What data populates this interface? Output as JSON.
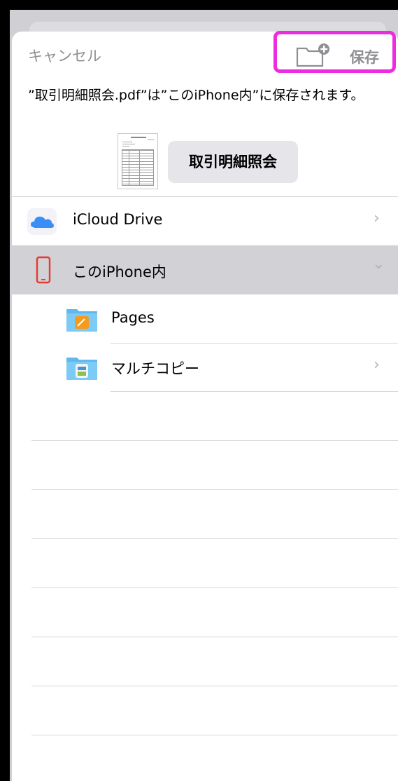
{
  "header": {
    "cancel_label": "キャンセル",
    "save_label": "保存",
    "new_folder_icon": "folder-plus-icon"
  },
  "message": "”取引明細照会.pdf”は”このiPhone内”に保存されます。",
  "file": {
    "name": "取引明細照会",
    "thumbnail_icon": "pdf-document-thumbnail"
  },
  "locations": [
    {
      "label": "iCloud Drive",
      "icon": "icloud-icon",
      "chevron": "›"
    },
    {
      "label": "このiPhone内",
      "icon": "iphone-icon",
      "chevron": "⌄",
      "selected": true
    }
  ],
  "folders": [
    {
      "label": "Pages",
      "icon": "pages-folder-icon"
    },
    {
      "label": "マルチコピー",
      "icon": "multicopy-folder-icon",
      "chevron": "›"
    }
  ],
  "colors": {
    "highlight": "#ee2be0",
    "accent_gray": "#8e8e93",
    "selected_row": "#d1d1d6",
    "folder_blue": "#6fc3f0",
    "iphone_red": "#e53b30"
  }
}
